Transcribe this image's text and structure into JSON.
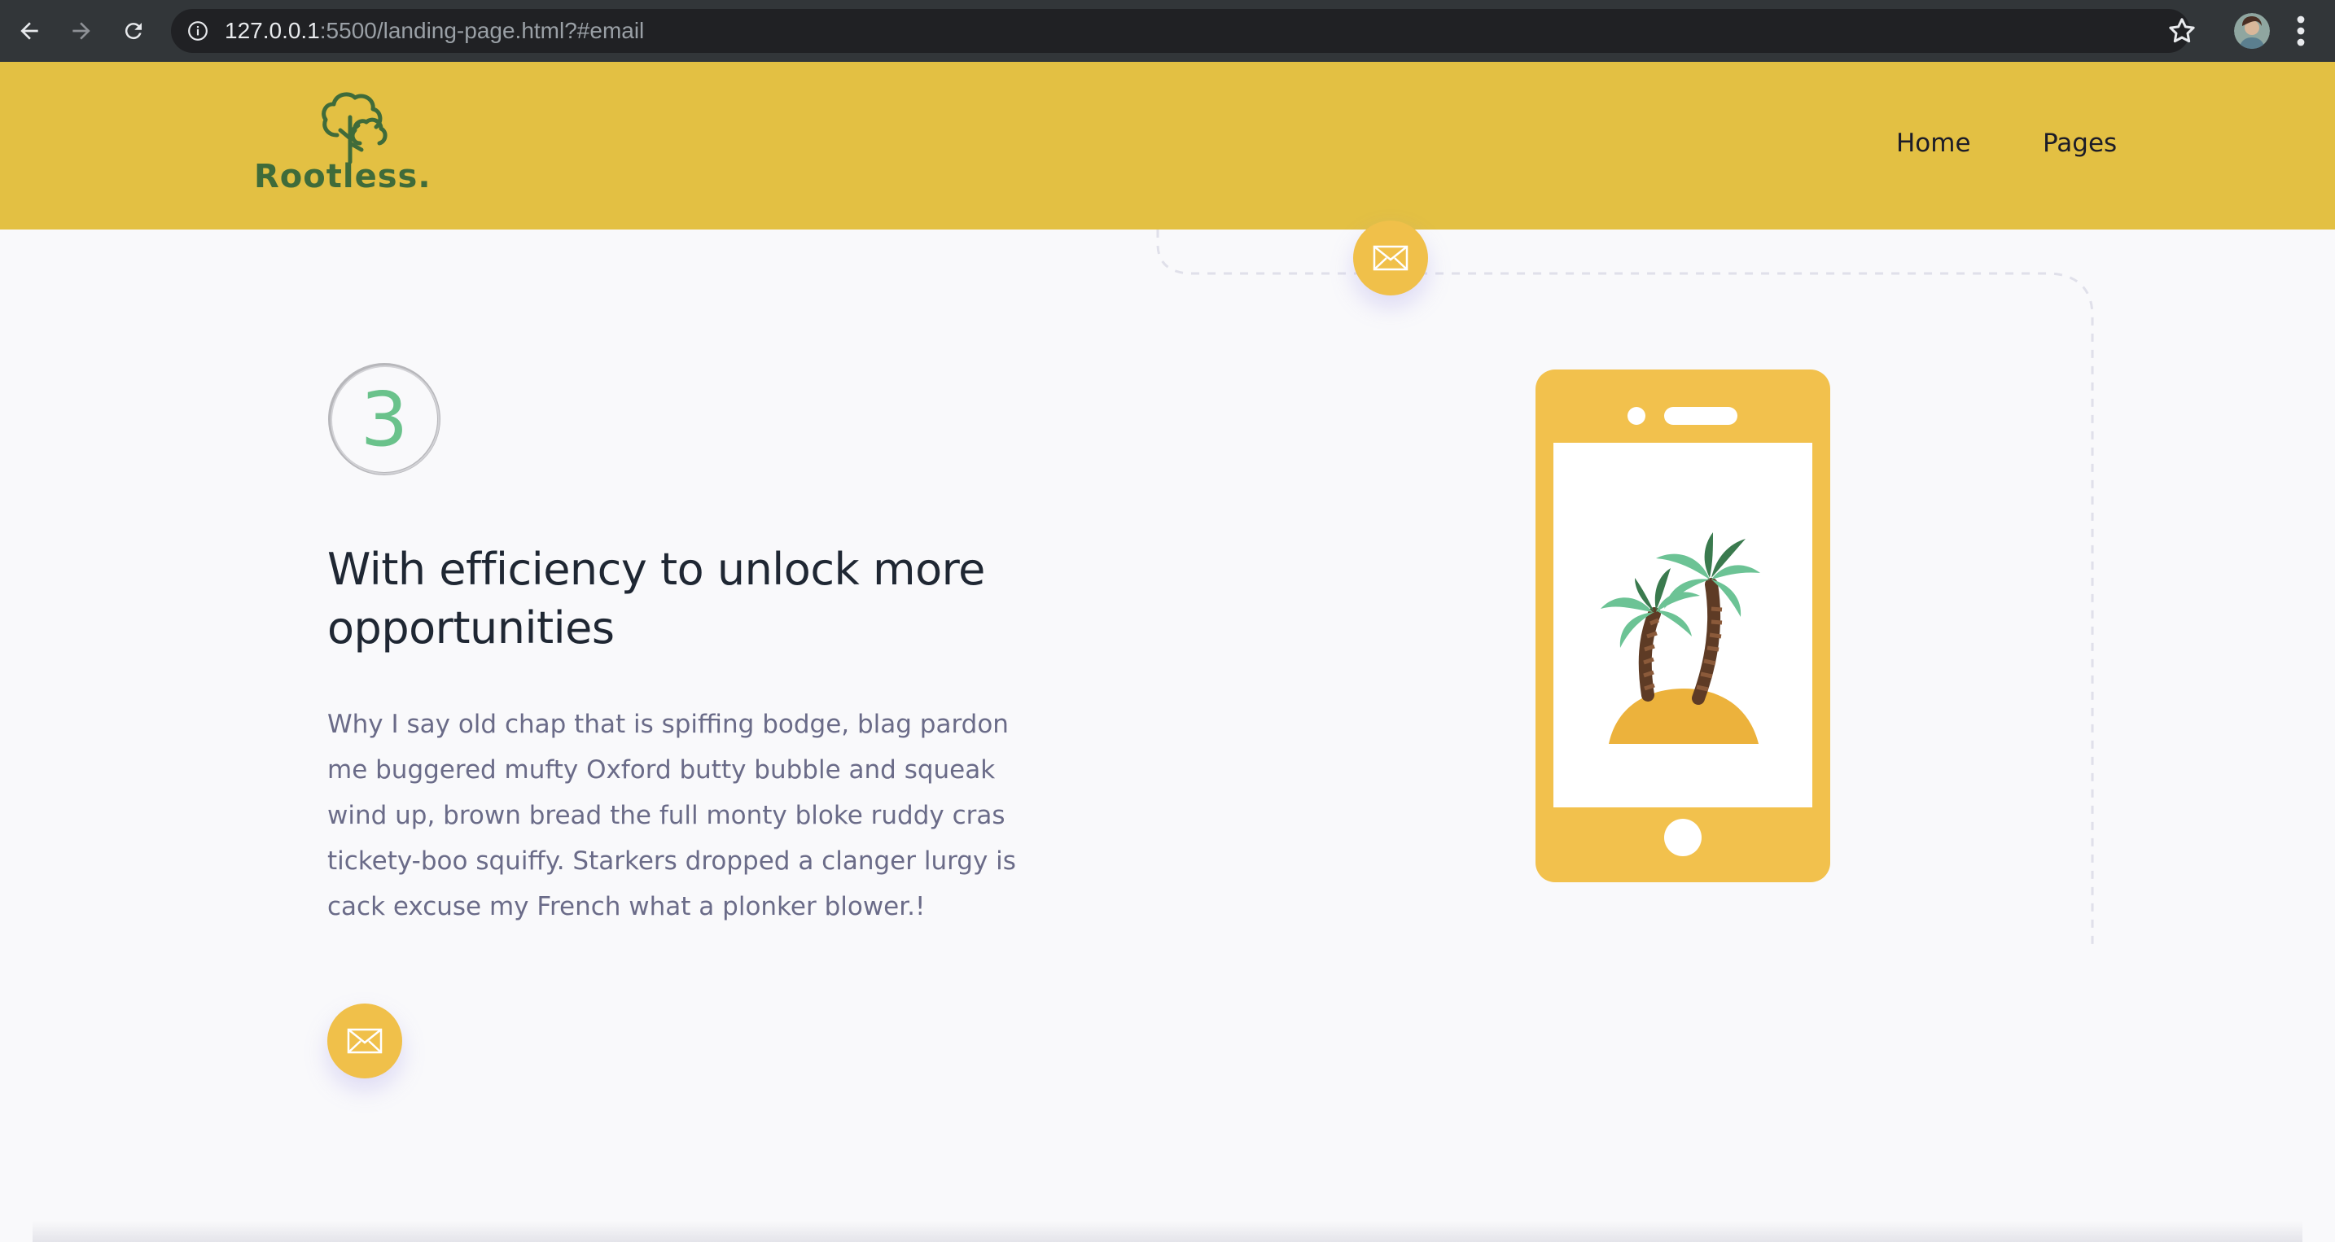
{
  "browser": {
    "url_host": "127.0.0.1",
    "url_rest": ":5500/landing-page.html?#email",
    "icons": {
      "back": "back-arrow-icon",
      "forward": "forward-arrow-icon",
      "reload": "reload-icon",
      "info": "info-icon",
      "star": "star-icon",
      "menu": "kebab-menu-icon"
    }
  },
  "header": {
    "logo_text": "Rootless.",
    "nav": [
      {
        "label": "Home"
      },
      {
        "label": "Pages"
      }
    ],
    "background_color": "#e3c043"
  },
  "feature": {
    "step_number": "3",
    "heading": "With efficiency to unlock more opportunities",
    "body": "Why I say old chap that is spiffing bodge, blag pardon me buggered mufty Oxford butty bubble and squeak wind up, brown bread the full monty bloke ruddy cras tickety-boo squiffy. Starkers dropped a clanger lurgy is cack excuse my French what a plonker blower.!",
    "accent_color": "#f0c04a",
    "illustration": "phone-with-palm-trees-illustration"
  }
}
